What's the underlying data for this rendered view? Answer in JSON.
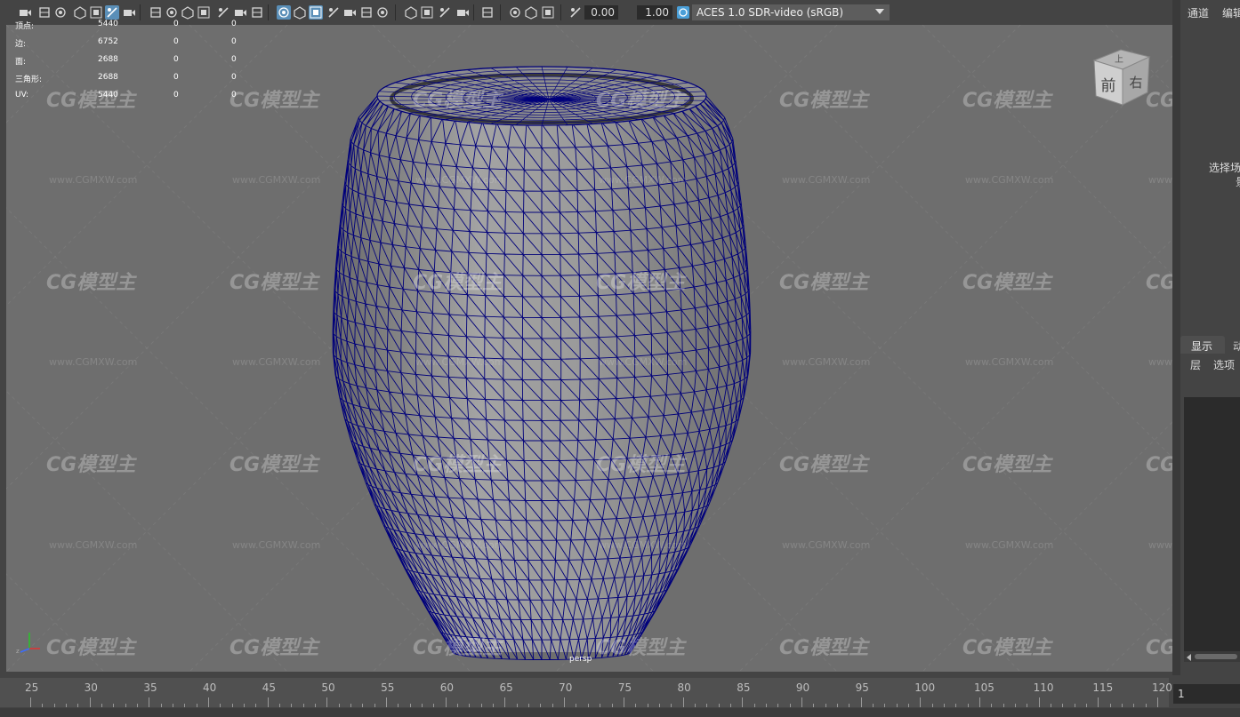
{
  "toolbar": {
    "exposure_value": "0.00",
    "gamma_value": "1.00",
    "color_space": "ACES 1.0 SDR-video (sRGB)",
    "icons": [
      "camera-select-icon",
      "camera-attributes-icon",
      "bookmark-icon",
      "image-plane-icon",
      "2d-pan-zoom-icon",
      "grease-pencil-icon",
      "grid-icon",
      "film-gate-icon",
      "resolution-gate-icon",
      "gate-mask-icon",
      "field-chart-icon",
      "safe-action-icon",
      "safe-title-icon",
      "wireframe-icon",
      "smooth-shade-icon",
      "default-material-icon",
      "wireframe-on-shaded-icon",
      "textured-icon",
      "use-all-lights-icon",
      "shadows-icon",
      "screen-space-ao-icon",
      "motion-blur-icon",
      "multisample-aa-icon",
      "depth-of-field-icon",
      "isolate-select-icon",
      "xray-icon",
      "xray-joints-icon",
      "xray-components-icon",
      "exposure-icon",
      "gamma-icon",
      "color-management-icon"
    ]
  },
  "hud": {
    "rows": [
      {
        "label": "顶点:",
        "v1": "5440",
        "v2": "0",
        "v3": "0"
      },
      {
        "label": "边:",
        "v1": "6752",
        "v2": "0",
        "v3": "0"
      },
      {
        "label": "面:",
        "v1": "2688",
        "v2": "0",
        "v3": "0"
      },
      {
        "label": "三角形:",
        "v1": "2688",
        "v2": "0",
        "v3": "0"
      },
      {
        "label": "UV:",
        "v1": "5440",
        "v2": "0",
        "v3": "0"
      }
    ]
  },
  "viewport": {
    "camera_label": "persp",
    "viewcube": {
      "top": "上",
      "front": "前",
      "right": "右"
    },
    "watermark": "CG模型主",
    "watermark_url": "www.CGMXW.com",
    "mesh_color": "#00007a",
    "background": "#6e6e6e"
  },
  "right_panel": {
    "tab_channels": "通道",
    "tab_edit": "编辑",
    "select_hint": "选择场",
    "select_hint_2": "景",
    "layer_tab_display": "显示",
    "layer_tab_anim": "动",
    "layer_menu_layers": "层",
    "layer_menu_options": "选项"
  },
  "timeline": {
    "ticks": [
      "25",
      "30",
      "35",
      "40",
      "45",
      "50",
      "55",
      "60",
      "65",
      "70",
      "75",
      "80",
      "85",
      "90",
      "95",
      "100",
      "105",
      "110",
      "115",
      "120"
    ],
    "current_frame": "1"
  }
}
